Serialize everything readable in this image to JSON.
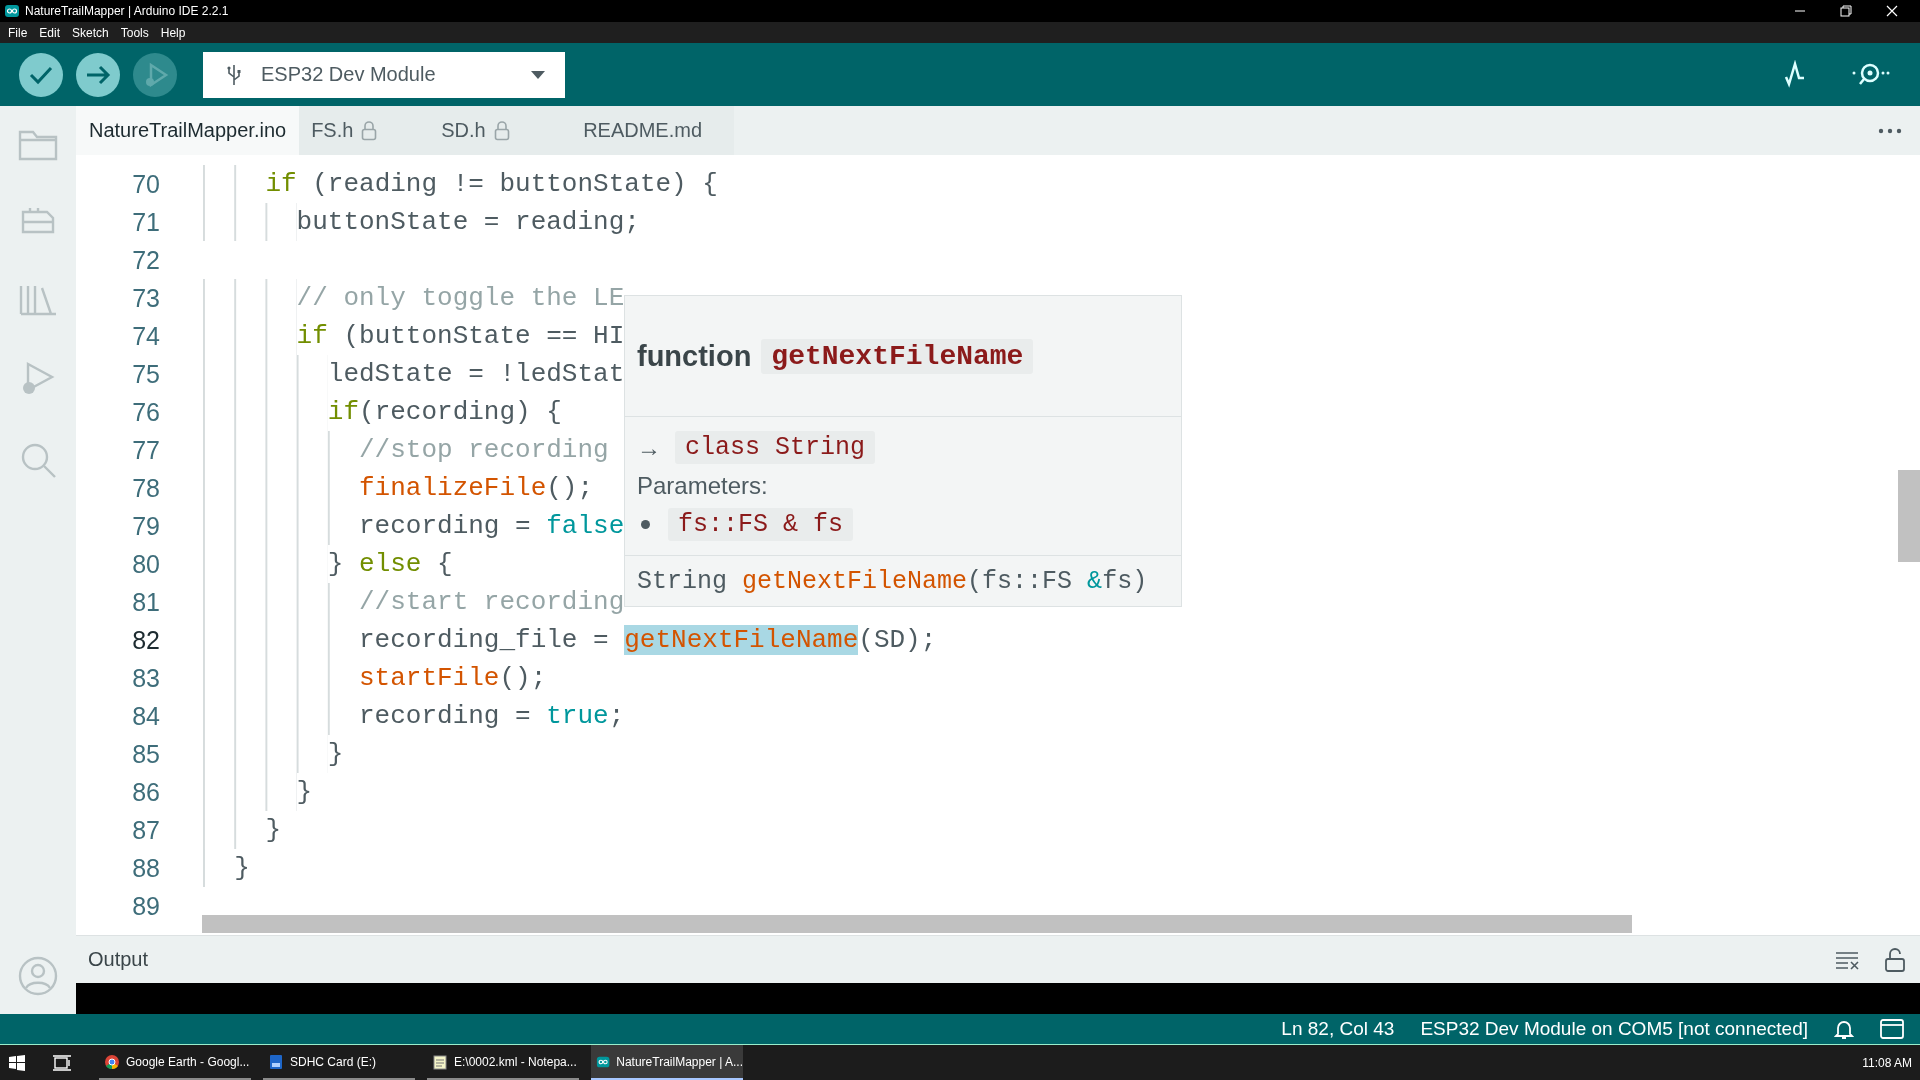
{
  "window": {
    "title": "NatureTrailMapper | Arduino IDE 2.2.1"
  },
  "menu": [
    "File",
    "Edit",
    "Sketch",
    "Tools",
    "Help"
  ],
  "toolbar": {
    "board": "ESP32 Dev Module"
  },
  "tabs": [
    {
      "label": "NatureTrailMapper.ino",
      "locked": false,
      "selected": true
    },
    {
      "label": "FS.h",
      "locked": true,
      "selected": false
    },
    {
      "label": "SD.h",
      "locked": true,
      "selected": false
    },
    {
      "label": "README.md",
      "locked": false,
      "selected": false
    }
  ],
  "editor": {
    "lines": [
      {
        "number": "70",
        "current": false,
        "tokens": [
          {
            "text": "    if",
            "kind": "keyword"
          },
          {
            "text": " (reading != buttonState) {",
            "kind": "plain"
          }
        ]
      },
      {
        "number": "71",
        "current": false,
        "tokens": [
          {
            "text": "      buttonState = reading;",
            "kind": "plain"
          }
        ]
      },
      {
        "number": "72",
        "current": false
      },
      {
        "number": "73",
        "current": false,
        "tokens": [
          {
            "text": "      // only toggle the LE",
            "kind": "comment"
          }
        ]
      },
      {
        "number": "74",
        "current": false,
        "tokens": [
          {
            "text": "      if",
            "kind": "keyword"
          },
          {
            "text": " (buttonState == HI",
            "kind": "plain"
          }
        ]
      },
      {
        "number": "75",
        "current": false,
        "tokens": [
          {
            "text": "        ledState = !ledStat",
            "kind": "plain"
          }
        ]
      },
      {
        "number": "76",
        "current": false,
        "tokens": [
          {
            "text": "        if",
            "kind": "keyword"
          },
          {
            "text": "(recording) {",
            "kind": "plain"
          }
        ]
      },
      {
        "number": "77",
        "current": false,
        "tokens": [
          {
            "text": "          //stop recording",
            "kind": "comment"
          }
        ]
      },
      {
        "number": "78",
        "current": false,
        "tokens": [
          {
            "text": "          finalizeFile",
            "kind": "function"
          },
          {
            "text": "();",
            "kind": "plain"
          }
        ]
      },
      {
        "number": "79",
        "current": false,
        "tokens": [
          {
            "text": "          recording = ",
            "kind": "plain"
          },
          {
            "text": "false",
            "kind": "constant"
          }
        ]
      },
      {
        "number": "80",
        "current": false,
        "tokens": [
          {
            "text": "        } ",
            "kind": "plain"
          },
          {
            "text": "else",
            "kind": "keyword"
          },
          {
            "text": " {",
            "kind": "plain"
          }
        ]
      },
      {
        "number": "81",
        "current": false,
        "tokens": [
          {
            "text": "          //start recording",
            "kind": "comment"
          }
        ]
      },
      {
        "number": "82",
        "current": true,
        "tokens": [
          {
            "text": "          recording_file = ",
            "kind": "plain"
          },
          {
            "text": "getNextFileName",
            "kind": "match"
          },
          {
            "text": "(SD);",
            "kind": "plain"
          }
        ]
      },
      {
        "number": "83",
        "current": false,
        "tokens": [
          {
            "text": "          startFile",
            "kind": "function"
          },
          {
            "text": "();",
            "kind": "plain"
          }
        ]
      },
      {
        "number": "84",
        "current": false,
        "tokens": [
          {
            "text": "          recording = ",
            "kind": "plain"
          },
          {
            "text": "true",
            "kind": "constant"
          },
          {
            "text": ";",
            "kind": "plain"
          }
        ]
      },
      {
        "number": "85",
        "current": false,
        "tokens": [
          {
            "text": "        }",
            "kind": "plain"
          }
        ]
      },
      {
        "number": "86",
        "current": false,
        "tokens": [
          {
            "text": "      }",
            "kind": "plain"
          }
        ]
      },
      {
        "number": "87",
        "current": false,
        "tokens": [
          {
            "text": "    }",
            "kind": "plain"
          }
        ]
      },
      {
        "number": "88",
        "current": false,
        "tokens": [
          {
            "text": "  }",
            "kind": "plain"
          }
        ]
      },
      {
        "number": "89",
        "current": false
      }
    ],
    "hover": {
      "kind_label": "function",
      "name": "getNextFileName",
      "arrow": "→",
      "return_type": "class String",
      "params_label": "Parameters:",
      "params": [
        "fs::FS & fs"
      ],
      "signature": [
        {
          "text": "String ",
          "kind": "plain"
        },
        {
          "text": "getNextFileName",
          "kind": "function"
        },
        {
          "text": "(fs::FS ",
          "kind": "plain"
        },
        {
          "text": "&",
          "kind": "constant"
        },
        {
          "text": "fs)",
          "kind": "plain"
        }
      ]
    }
  },
  "output": {
    "title": "Output"
  },
  "status_bar": {
    "position": "Ln 82, Col 43",
    "board": "ESP32 Dev Module on COM5 [not connected]"
  },
  "taskbar": {
    "apps": [
      {
        "label": "Google Earth - Googl...",
        "kind": "browser",
        "active": false
      },
      {
        "label": "SDHC Card (E:)",
        "kind": "drive",
        "active": false
      },
      {
        "label": "E:\\0002.kml - Notepa...",
        "kind": "notepad",
        "active": false
      },
      {
        "label": "NatureTrailMapper | A...",
        "kind": "arduino",
        "active": true
      }
    ],
    "time": "11:08 AM"
  }
}
